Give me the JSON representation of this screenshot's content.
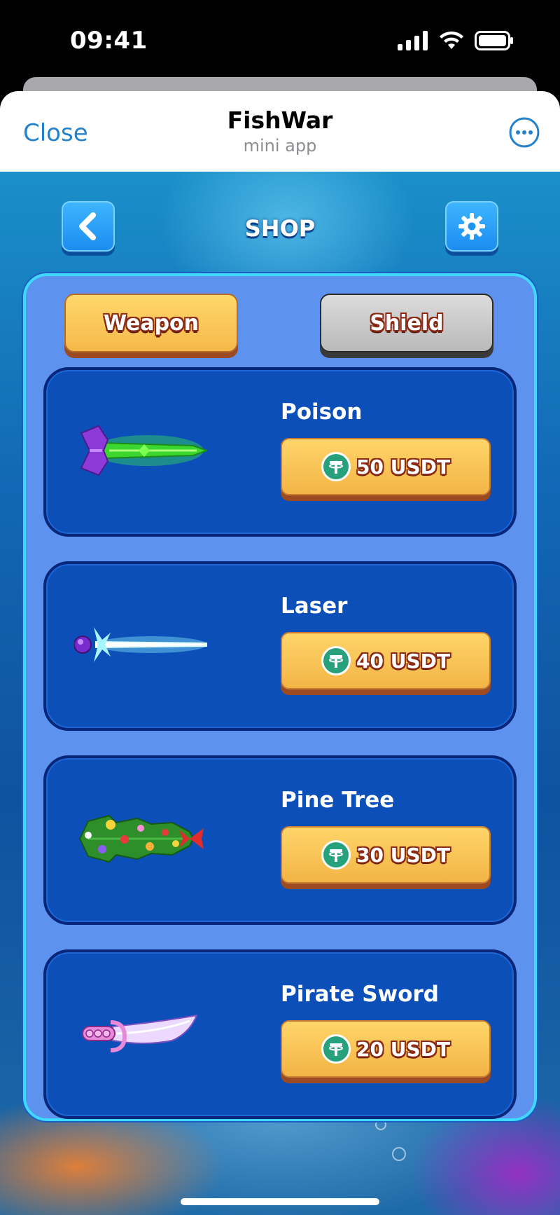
{
  "status_bar": {
    "time": "09:41"
  },
  "telegram_header": {
    "close_label": "Close",
    "title": "FishWar",
    "subtitle": "mini app",
    "accent_color": "#2481cc"
  },
  "game": {
    "title": "SHOP",
    "back_icon": "chevron-left-icon",
    "settings_icon": "gear-icon",
    "tabs": [
      {
        "label": "Weapon",
        "active": true
      },
      {
        "label": "Shield",
        "active": false
      }
    ],
    "items": [
      {
        "name": "Poison",
        "price": "50 USDT",
        "icon": "poison-sword-icon"
      },
      {
        "name": "Laser",
        "price": "40 USDT",
        "icon": "laser-blade-icon"
      },
      {
        "name": "Pine Tree",
        "price": "30 USDT",
        "icon": "pine-tree-weapon-icon"
      },
      {
        "name": "Pirate Sword",
        "price": "20 USDT",
        "icon": "pirate-sword-icon"
      }
    ],
    "currency_icon": "usdt-icon"
  }
}
